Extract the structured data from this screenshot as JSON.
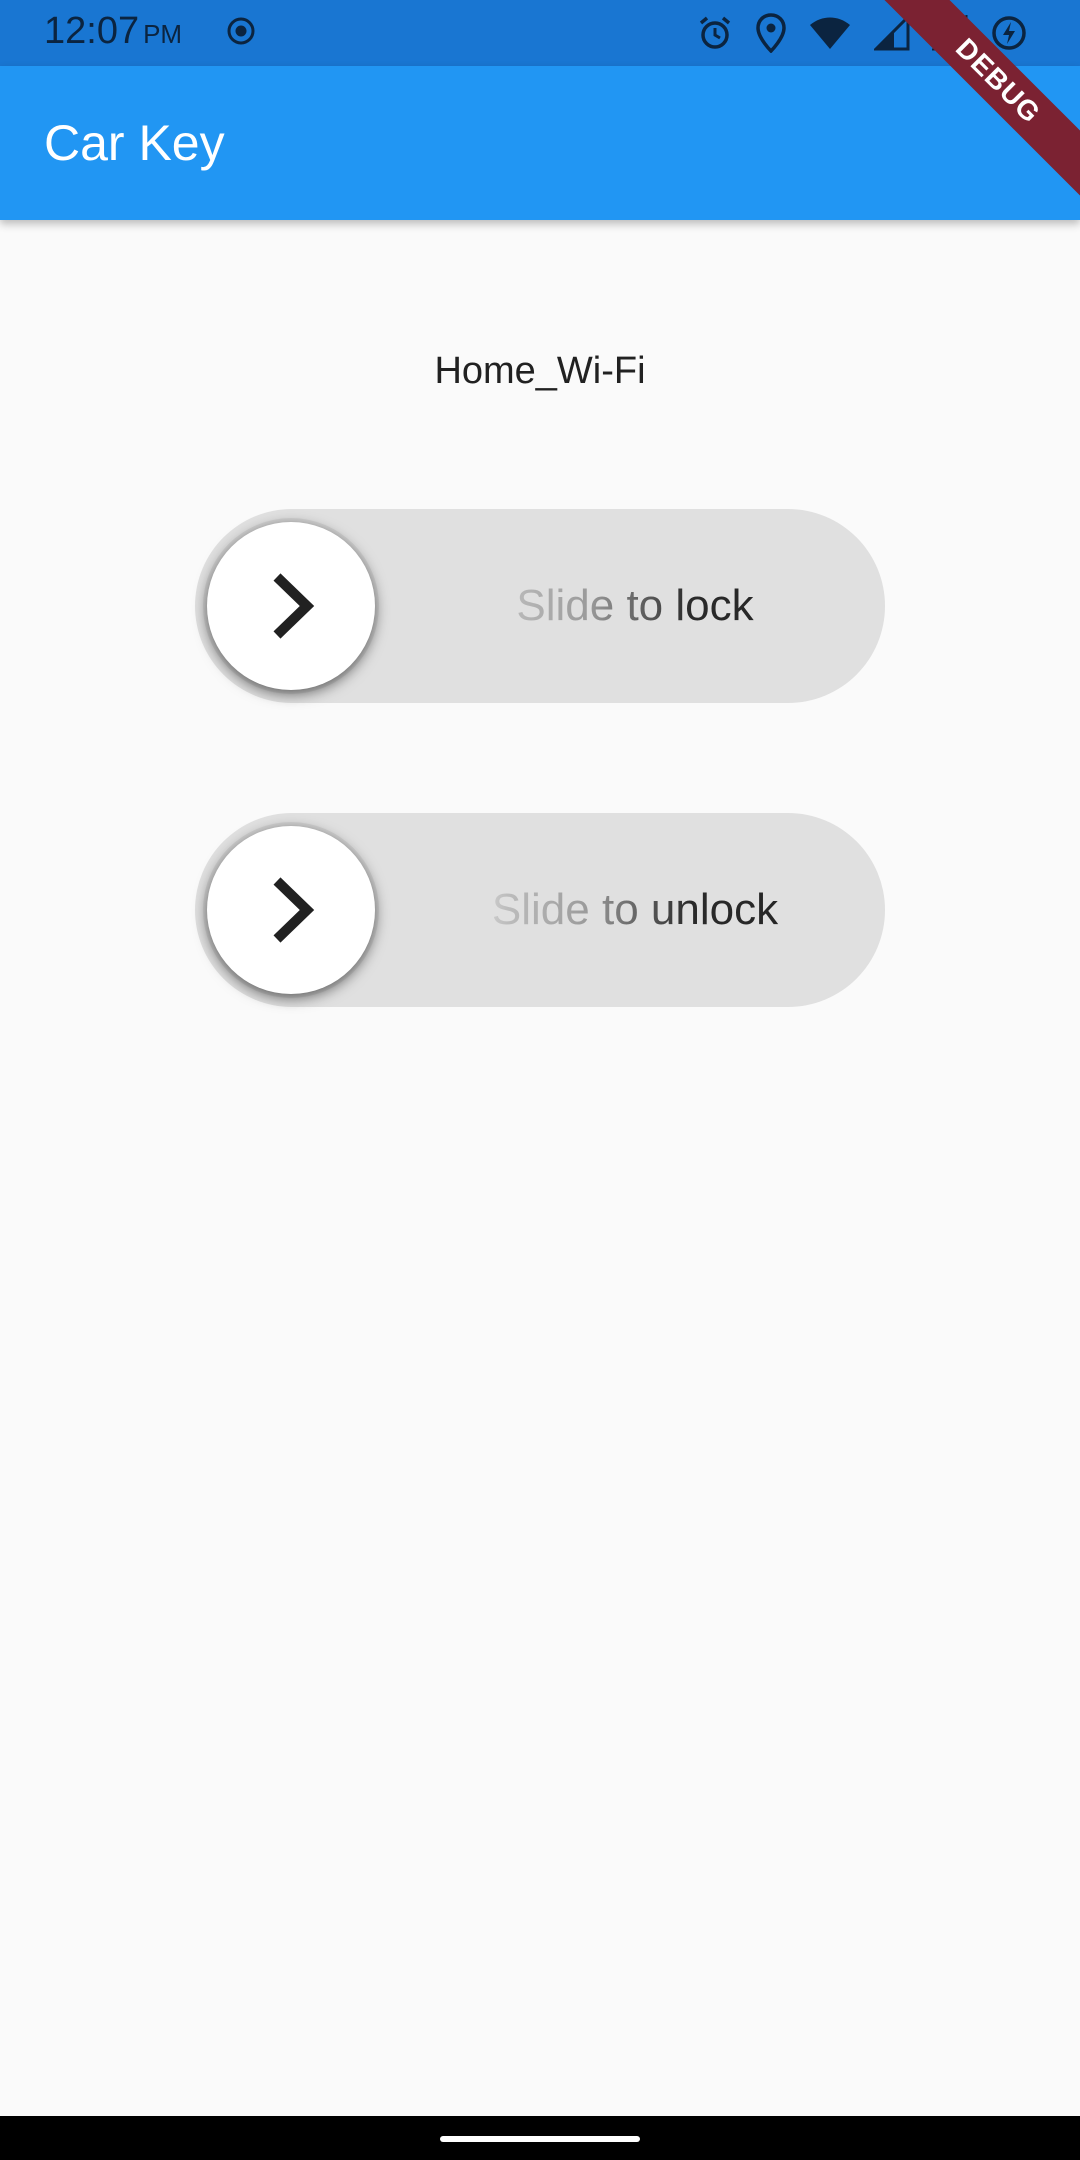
{
  "status_bar": {
    "time": "12:07",
    "ampm": "PM",
    "icons": [
      "record-icon",
      "alarm-icon",
      "location-icon",
      "wifi-icon",
      "signal-icon",
      "signal-icon",
      "battery-charging-icon"
    ]
  },
  "app_bar": {
    "title": "Car Key",
    "color": "#2196f3"
  },
  "debug_banner": "DEBUG",
  "network": {
    "name": "Home_Wi-Fi"
  },
  "sliders": [
    {
      "label": "Slide to lock",
      "icon": "chevron-right-icon"
    },
    {
      "label": "Slide to unlock",
      "icon": "chevron-right-icon"
    }
  ]
}
